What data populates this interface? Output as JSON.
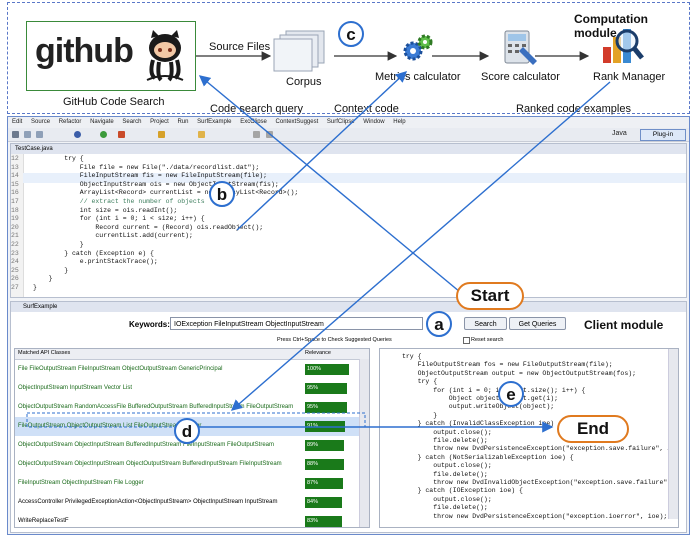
{
  "computation_module": {
    "title": "Computation module",
    "github_logo_text": "github",
    "github_caption": "GitHub Code Search",
    "source_files_label": "Source Files",
    "corpus_label": "Corpus",
    "metrics_label": "Metrics calculator",
    "score_label": "Score calculator",
    "rank_label": "Rank Manager",
    "code_query_label": "Code  search query",
    "context_code_label": "Context   code",
    "ranked_label": "Ranked code   examples"
  },
  "markers": {
    "a": "a",
    "b": "b",
    "c": "c",
    "d": "d",
    "e": "e",
    "start": "Start",
    "end": "End"
  },
  "ide": {
    "menu": [
      "Edit",
      "Source",
      "Refactor",
      "Navigate",
      "Search",
      "Project",
      "Run",
      "SurfExample",
      "ExcClipse",
      "ContextSuggest",
      "SurfClipse",
      "Window",
      "Help"
    ],
    "editor_tab": "TestCase.java",
    "perspective": "Java",
    "plugin_label": "Plug-in",
    "code_lines": [
      {
        "n": "12",
        "t": "        try {"
      },
      {
        "n": "13",
        "t": "            File file = new File(\"./data/recordlist.dat\");"
      },
      {
        "n": "14",
        "t": "            FileInputStream fis = new FileInputStream(file);"
      },
      {
        "n": "15",
        "t": "            ObjectInputStream ois = new ObjectInputStream(fis);"
      },
      {
        "n": "16",
        "t": "            ArrayList<Record> currentList = new ArrayList<Record>();"
      },
      {
        "n": "17",
        "t": "            // extract the number of objects"
      },
      {
        "n": "18",
        "t": "            int size = ois.readInt();"
      },
      {
        "n": "19",
        "t": "            for (int i = 0; i < size; i++) {"
      },
      {
        "n": "20",
        "t": "                Record current = (Record) ois.readObject();"
      },
      {
        "n": "21",
        "t": "                currentList.add(current);"
      },
      {
        "n": "22",
        "t": "            }"
      },
      {
        "n": "23",
        "t": "        } catch (Exception e) {"
      },
      {
        "n": "24",
        "t": "            e.printStackTrace();"
      },
      {
        "n": "25",
        "t": "        }"
      },
      {
        "n": "26",
        "t": "    }"
      },
      {
        "n": "27",
        "t": "}"
      }
    ],
    "panel_tab": "SurfExample",
    "keywords_label": "Keywords:",
    "keywords_value": "IOException  FileInputStream  ObjectInputStream",
    "search_button": "Search",
    "queries_button": "Get Queries",
    "client_module_label": "Client module",
    "hint": "Press Ctrl+Space to Check Suggested Queries",
    "reset_label": "Reset search",
    "table_headers": {
      "classes": "Matched API Classes",
      "relevance": "Relevance"
    },
    "table_rows": [
      {
        "text": "File FileOutputStream FileInputStream ObjectOutputStream GenericPrincipal",
        "rel": "100%"
      },
      {
        "text": "ObjectInputStream InputStream Vector List",
        "rel": "95%"
      },
      {
        "text": "ObjectOutputStream RandomAccessFile BufferedOutputStream BufferedInputStream FileOutputStream",
        "rel": "95%"
      },
      {
        "text": "FileOutputStream ObjectOutputStream List FileOutputStream Logger",
        "rel": "91%"
      },
      {
        "text": "ObjectOutputStream ObjectInputStream BufferedInputStream FileInputStream FileOutputStream",
        "rel": "89%"
      },
      {
        "text": "ObjectOutputStream ObjectInputStream ObjectOutputStream BufferedInputStream FileInputStream",
        "rel": "88%"
      },
      {
        "text": "FileInputStream ObjectInputStream File Logger",
        "rel": "87%"
      },
      {
        "text": "AccessController PrivilegedExceptionAction<ObjectInputStream> ObjectInputStream InputStream",
        "rel": "84%"
      },
      {
        "text": "WriteReplaceTestF",
        "rel": "83%"
      }
    ],
    "example_code": [
      "try {",
      "    FileOutputStream fos = new FileOutputStream(file);",
      "    ObjectOutputStream output = new ObjectOutputStream(fos);",
      "    try {",
      "        for (int i = 0; i < list.size(); i++) {",
      "            Object object = list.get(i);",
      "            output.writeObject(object);",
      "        }",
      "    } catch (InvalidClassException ioe) {",
      "        output.close();",
      "        file.delete();",
      "        throw new DvdPersistenceException(\"exception.save.failure\", i",
      "    } catch (NotSerializableException ioe) {",
      "        output.close();",
      "        file.delete();",
      "        throw new DvdInvalidObjectException(\"exception.save.failure\",",
      "    } catch (IOException ioe) {",
      "        output.close();",
      "        file.delete();",
      "        throw new DvdPersistenceException(\"exception.ioerror\", ioe);"
    ]
  }
}
